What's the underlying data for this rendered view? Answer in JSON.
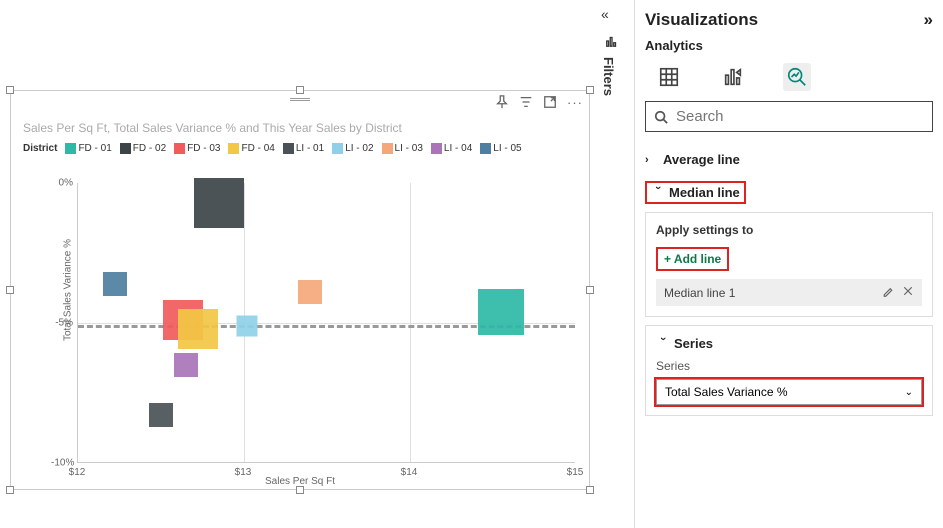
{
  "panel": {
    "title": "Visualizations",
    "subtitle": "Analytics",
    "search_placeholder": "Search",
    "avg_line": "Average line",
    "median_line": "Median line",
    "apply_settings": "Apply settings to",
    "add_line": "+ Add line",
    "line_name": "Median line 1",
    "series_head": "Series",
    "series_label": "Series",
    "series_value": "Total Sales Variance %"
  },
  "filters_label": "Filters",
  "chart": {
    "title": "Sales Per Sq Ft, Total Sales Variance % and This Year Sales by District",
    "legend_title": "District",
    "xlabel": "Sales Per Sq Ft",
    "ylabel": "Total Sales Variance %"
  },
  "legend": [
    {
      "label": "FD - 01",
      "color": "#2eb9a6"
    },
    {
      "label": "FD - 02",
      "color": "#3d4448"
    },
    {
      "label": "FD - 03",
      "color": "#f15b5b"
    },
    {
      "label": "FD - 04",
      "color": "#f2c744"
    },
    {
      "label": "LI - 01",
      "color": "#4a5257"
    },
    {
      "label": "LI - 02",
      "color": "#8fd0e8"
    },
    {
      "label": "LI - 03",
      "color": "#f5a77a"
    },
    {
      "label": "LI - 04",
      "color": "#a974b8"
    },
    {
      "label": "LI - 05",
      "color": "#4e7fa0"
    }
  ],
  "yticks": [
    "0%",
    "-5%",
    "-10%"
  ],
  "xticks": [
    "$12",
    "$13",
    "$14",
    "$15"
  ],
  "chart_data": {
    "type": "scatter",
    "title": "Sales Per Sq Ft, Total Sales Variance % and This Year Sales by District",
    "xlabel": "Sales Per Sq Ft",
    "ylabel": "Total Sales Variance %",
    "size_field": "This Year Sales",
    "xlim": [
      12,
      15
    ],
    "ylim": [
      -10,
      0
    ],
    "median_y": -5.1,
    "series": [
      {
        "name": "FD - 01",
        "color": "#2eb9a6",
        "x": 14.55,
        "y": -4.6,
        "size": 46
      },
      {
        "name": "FD - 02",
        "color": "#3d4448",
        "x": 12.85,
        "y": -0.7,
        "size": 50
      },
      {
        "name": "FD - 03",
        "color": "#f15b5b",
        "x": 12.63,
        "y": -4.9,
        "size": 40
      },
      {
        "name": "FD - 04",
        "color": "#f2c744",
        "x": 12.72,
        "y": -5.2,
        "size": 40
      },
      {
        "name": "LI - 01",
        "color": "#4a5257",
        "x": 12.5,
        "y": -8.3,
        "size": 24
      },
      {
        "name": "LI - 02",
        "color": "#8fd0e8",
        "x": 13.02,
        "y": -5.1,
        "size": 21
      },
      {
        "name": "LI - 03",
        "color": "#f5a77a",
        "x": 13.4,
        "y": -3.9,
        "size": 24
      },
      {
        "name": "LI - 04",
        "color": "#a974b8",
        "x": 12.65,
        "y": -6.5,
        "size": 24
      },
      {
        "name": "LI - 05",
        "color": "#4e7fa0",
        "x": 12.22,
        "y": -3.6,
        "size": 24
      }
    ]
  }
}
